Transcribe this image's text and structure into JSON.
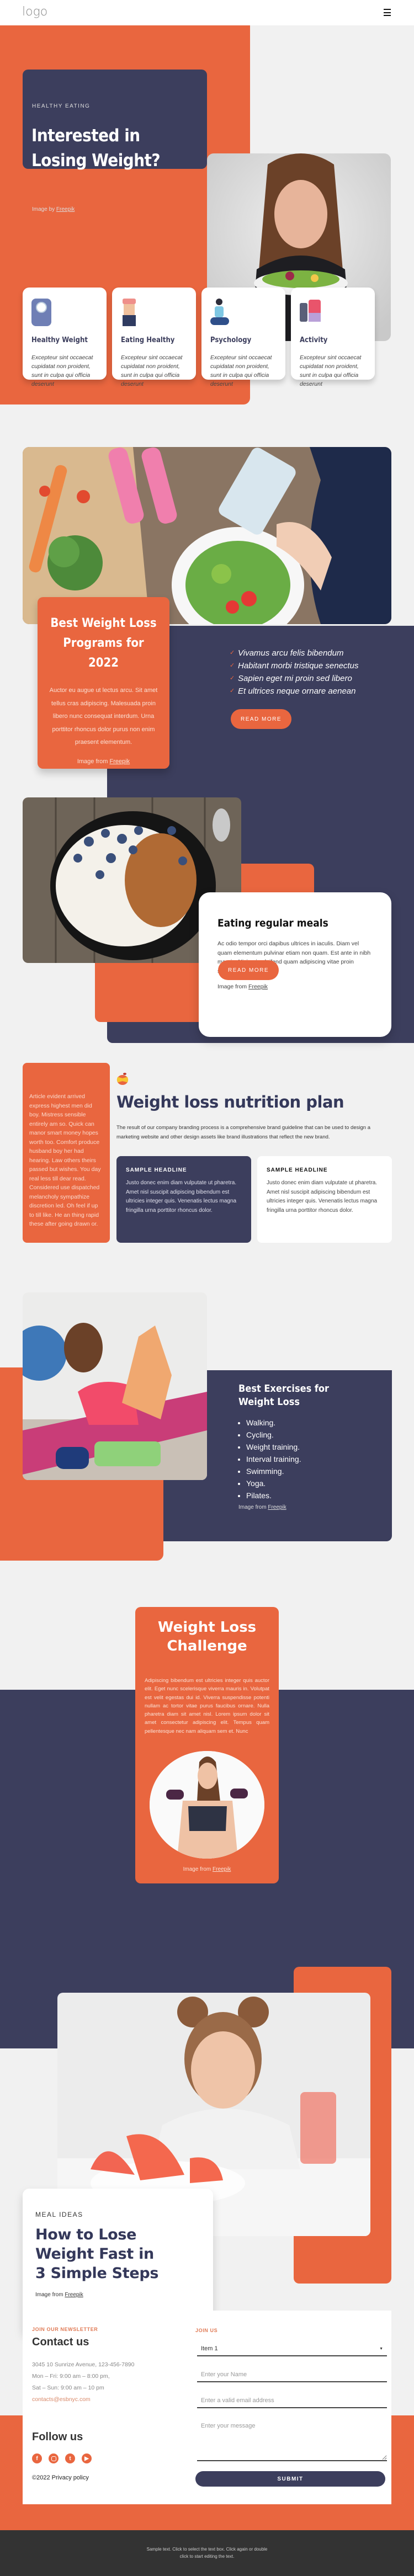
{
  "header": {
    "logo": "logo",
    "menu_icon": "hamburger-menu-icon"
  },
  "colors": {
    "orange": "#e9663f",
    "navy": "#3c3e5d",
    "background": "#f1f1f1",
    "footer": "#333333"
  },
  "hero": {
    "eyebrow": "HEALTHY EATING",
    "title_line1": "Interested in",
    "title_line2": "Losing Weight?",
    "credit_prefix": "Image by ",
    "credit_link": "Freepik",
    "features": [
      {
        "icon": "scale-icon",
        "title": "Healthy Weight",
        "text": "Excepteur sint occaecat cupidatat non proident, sunt in culpa qui officia deserunt"
      },
      {
        "icon": "waist-icon",
        "title": "Eating Healthy",
        "text": "Excepteur sint occaecat cupidatat non proident, sunt in culpa qui officia deserunt"
      },
      {
        "icon": "yoga-icon",
        "title": "Psychology",
        "text": "Excepteur sint occaecat cupidatat non proident, sunt in culpa qui officia deserunt"
      },
      {
        "icon": "dumbbell-icon",
        "title": "Activity",
        "text": "Excepteur sint occaecat cupidatat non proident, sunt in culpa qui officia deserunt"
      }
    ]
  },
  "programs": {
    "title_line1": "Best Weight Loss",
    "title_line2": "Programs for 2022",
    "body": "Auctor eu augue ut lectus arcu. Sit amet tellus cras adipiscing. Malesuada proin libero nunc consequat interdum. Urna porttitor rhoncus dolor purus non enim praesent elementum.",
    "credit_prefix": "Image from ",
    "credit_link": "Freepik",
    "checklist": [
      "Vivamus arcu felis bibendum",
      "Habitant morbi tristique senectus",
      "Sapien eget mi proin sed libero",
      "Et ultrices neque ornare aenean"
    ],
    "button": "READ MORE"
  },
  "meals": {
    "title": "Eating regular meals",
    "body": "Ac odio tempor orci dapibus ultrices in iaculis. Diam vel quam elementum pulvinar etiam non quam. Est ante in nibh mauris. Nisi quis eleifend quam adipiscing vitae proin sagittis.",
    "credit_prefix": "Image from ",
    "credit_link": "Freepik",
    "button": "READ MORE"
  },
  "nutrition": {
    "side_text": "Article evident arrived express highest men did boy. Mistress sensible entirely am so. Quick can manor smart money hopes worth too. Comfort produce husband boy her had hearing. Law others theirs passed but wishes. You day real less till dear read. Considered use dispatched melancholy sympathize discretion led. Oh feel if up to till like. He an thing rapid these after going drawn or.",
    "title": "Weight loss nutrition plan",
    "intro": "The result of our company branding process is a comprehensive brand guideline that can be used to design a marketing website and other design assets like brand illustrations that reflect the new brand.",
    "cards": [
      {
        "headline": "SAMPLE HEADLINE",
        "text": "Justo donec enim diam vulputate ut pharetra. Amet nisl suscipit adipiscing bibendum est ultricies integer quis. Venenatis lectus magna fringilla urna porttitor rhoncus dolor."
      },
      {
        "headline": "SAMPLE HEADLINE",
        "text": "Justo donec enim diam vulputate ut pharetra. Amet nisl suscipit adipiscing bibendum est ultricies integer quis. Venenatis lectus magna fringilla urna porttitor rhoncus dolor."
      }
    ]
  },
  "exercises": {
    "title_line1": "Best Exercises for",
    "title_line2": "Weight Loss",
    "items": [
      "Walking.",
      "Cycling.",
      "Weight training.",
      "Interval training.",
      "Swimming.",
      "Yoga.",
      "Pilates."
    ],
    "credit_prefix": "Image from ",
    "credit_link": "Freepik"
  },
  "challenge": {
    "title_line1": "Weight Loss",
    "title_line2": "Challenge",
    "body": "Adipiscing bibendum est ultricies integer quis auctor elit. Eget nunc scelerisque viverra mauris in. Volutpat est velit egestas dui id. Viverra suspendisse potenti nullam ac tortor vitae purus faucibus ornare. Nulla pharetra diam sit amet nisl. Lorem ipsum dolor sit amet consectetur adipiscing elit. Tempus quam pellentesque nec nam aliquam sem et. Nunc",
    "credit_prefix": "Image from ",
    "credit_link": "Freepik"
  },
  "steps": {
    "eyebrow": "MEAL IDEAS",
    "title_line1": "How to Lose",
    "title_line2": "Weight Fast in",
    "title_line3": "3 Simple Steps",
    "credit_prefix": "Image from ",
    "credit_link": "Freepik"
  },
  "contact": {
    "eyebrow": "JOIN OUR NEWSLETTER",
    "title": "Contact us",
    "address": "3045 10 Sunrize Avenue, 123-456-7890",
    "hours_weekday": "Mon – Fri: 9:00 am – 8:00 pm,",
    "hours_weekend": "Sat – Sun: 9:00 am – 10 pm",
    "email": "contacts@esbnyc.com",
    "follow_title": "Follow us",
    "socials": [
      "facebook-icon",
      "instagram-icon",
      "twitter-icon",
      "youtube-icon"
    ],
    "copyright": "©2022 Privacy policy"
  },
  "form": {
    "eyebrow": "JOIN US",
    "select_value": "Item 1",
    "name_placeholder": "Enter your Name",
    "email_placeholder": "Enter a valid email address",
    "message_placeholder": "Enter your message",
    "submit": "SUBMIT"
  },
  "footer": {
    "line1": "Sample text. Click to select the text box. Click again or double",
    "line2": "click to start editing the text."
  }
}
